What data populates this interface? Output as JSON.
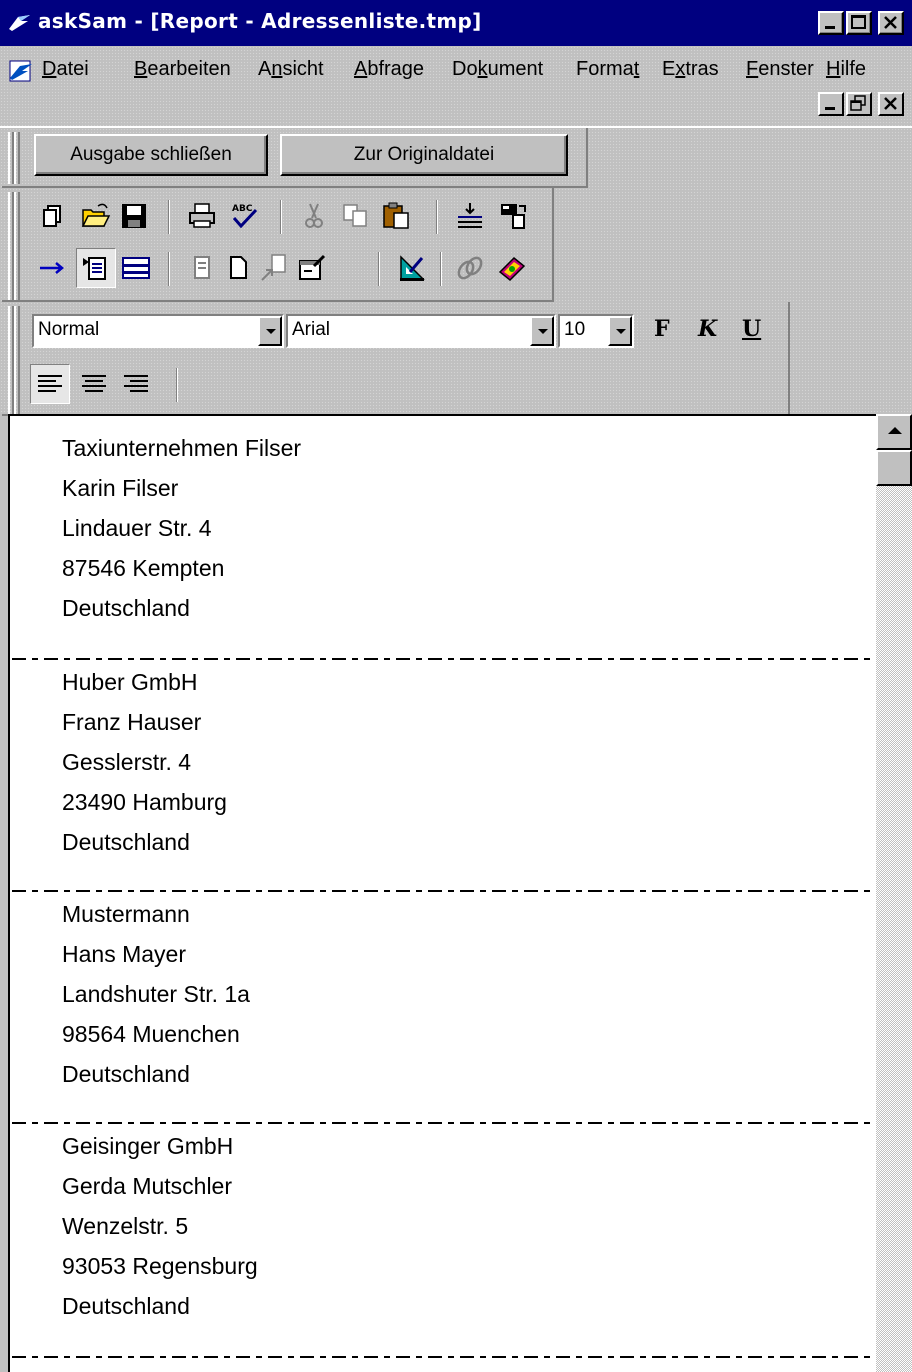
{
  "window": {
    "title": "askSam - [Report - Adressenliste.tmp]",
    "title_color": "#000080"
  },
  "menu": {
    "items": [
      {
        "key": "D",
        "rest": "atei"
      },
      {
        "key": "B",
        "rest": "earbeiten"
      },
      {
        "pre": "A",
        "key": "n",
        "rest": "sicht"
      },
      {
        "key": "A",
        "rest": "bfrage"
      },
      {
        "pre": "Do",
        "key": "k",
        "rest": "ument"
      },
      {
        "pre": "Forma",
        "key": "t",
        "rest": ""
      },
      {
        "pre": "E",
        "key": "x",
        "rest": "tras"
      },
      {
        "key": "F",
        "rest": "enster"
      },
      {
        "key": "H",
        "rest": "ilfe"
      }
    ]
  },
  "report_toolbar": {
    "close_output_label": "Ausgabe schließen",
    "to_original_label": "Zur Originaldatei"
  },
  "format_toolbar": {
    "style": "Normal",
    "font": "Arial",
    "size": "10",
    "bold_label": "F",
    "italic_label": "K",
    "underline_label": "U"
  },
  "icons": {
    "standard_row1": [
      "new-document-icon",
      "open-folder-icon",
      "save-disk-icon",
      "print-icon",
      "spellcheck-icon",
      "cut-icon",
      "copy-icon",
      "paste-icon",
      "insert-line-icon",
      "field-icon"
    ],
    "standard_row2": [
      "arrow-right-icon",
      "document-view-icon",
      "form-view-icon",
      "page-icon",
      "blank-page-icon",
      "move-document-icon",
      "properties-icon",
      "query-icon",
      "link-icon",
      "help-book-icon"
    ],
    "align": [
      "align-left-icon",
      "align-center-icon",
      "align-right-icon"
    ]
  },
  "records": [
    [
      "Taxiunternehmen Filser",
      "Karin Filser",
      "Lindauer Str. 4",
      "87546 Kempten",
      "Deutschland"
    ],
    [
      "Huber GmbH",
      "Franz Hauser",
      "Gesslerstr. 4",
      "23490 Hamburg",
      "Deutschland"
    ],
    [
      "Mustermann",
      "Hans Mayer",
      "Landshuter Str. 1a",
      "98564 Muenchen",
      "Deutschland"
    ],
    [
      "Geisinger GmbH",
      "Gerda Mutschler",
      "Wenzelstr. 5",
      "93053 Regensburg",
      "Deutschland"
    ]
  ]
}
